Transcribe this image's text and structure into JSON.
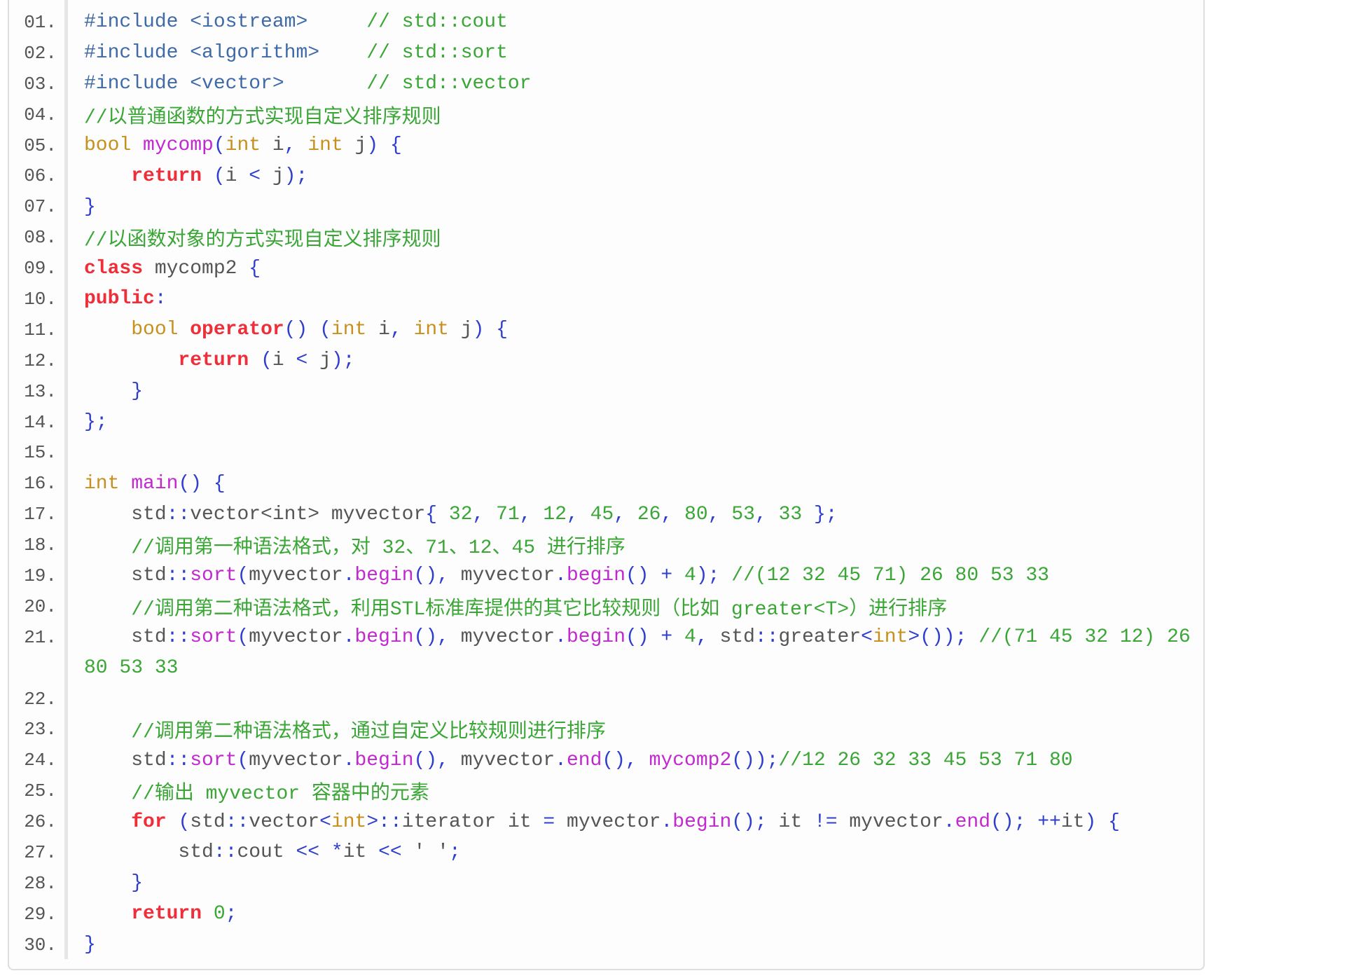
{
  "colors": {
    "preprocessor": "#3f6aa8",
    "comment": "#3aa636",
    "type": "#c7901d",
    "function": "#c128cf",
    "keyword": "#ee2f3a",
    "punctuation": "#2f3fcc",
    "number": "#3aa636",
    "identifier": "#555555",
    "line_number": "#555555"
  },
  "lines": [
    {
      "num": "01.",
      "tokens": [
        [
          "pre",
          "#include <iostream>"
        ],
        [
          "id",
          "     "
        ],
        [
          "cm",
          "// std::cout"
        ]
      ]
    },
    {
      "num": "02.",
      "tokens": [
        [
          "pre",
          "#include <algorithm>"
        ],
        [
          "id",
          "    "
        ],
        [
          "cm",
          "// std::sort"
        ]
      ]
    },
    {
      "num": "03.",
      "tokens": [
        [
          "pre",
          "#include <vector>"
        ],
        [
          "id",
          "       "
        ],
        [
          "cm",
          "// std::vector"
        ]
      ]
    },
    {
      "num": "04.",
      "tokens": [
        [
          "cm",
          "//以普通函数的方式实现自定义排序规则"
        ]
      ]
    },
    {
      "num": "05.",
      "tokens": [
        [
          "type",
          "bool"
        ],
        [
          "id",
          " "
        ],
        [
          "fn",
          "mycomp"
        ],
        [
          "p",
          "("
        ],
        [
          "type",
          "int"
        ],
        [
          "id",
          " i"
        ],
        [
          "p",
          ","
        ],
        [
          "id",
          " "
        ],
        [
          "type",
          "int"
        ],
        [
          "id",
          " j"
        ],
        [
          "p",
          ")"
        ],
        [
          "id",
          " "
        ],
        [
          "p",
          "{"
        ]
      ]
    },
    {
      "num": "06.",
      "tokens": [
        [
          "id",
          "    "
        ],
        [
          "kw",
          "return"
        ],
        [
          "id",
          " "
        ],
        [
          "p",
          "("
        ],
        [
          "id",
          "i "
        ],
        [
          "p",
          "<"
        ],
        [
          "id",
          " j"
        ],
        [
          "p",
          ");"
        ]
      ]
    },
    {
      "num": "07.",
      "tokens": [
        [
          "p",
          "}"
        ]
      ]
    },
    {
      "num": "08.",
      "tokens": [
        [
          "cm",
          "//以函数对象的方式实现自定义排序规则"
        ]
      ]
    },
    {
      "num": "09.",
      "tokens": [
        [
          "kw",
          "class"
        ],
        [
          "id",
          " mycomp2 "
        ],
        [
          "p",
          "{"
        ]
      ]
    },
    {
      "num": "10.",
      "tokens": [
        [
          "kw",
          "public"
        ],
        [
          "p",
          ":"
        ]
      ]
    },
    {
      "num": "11.",
      "tokens": [
        [
          "id",
          "    "
        ],
        [
          "type",
          "bool"
        ],
        [
          "id",
          " "
        ],
        [
          "kw",
          "operator"
        ],
        [
          "p",
          "()"
        ],
        [
          "id",
          " "
        ],
        [
          "p",
          "("
        ],
        [
          "type",
          "int"
        ],
        [
          "id",
          " i"
        ],
        [
          "p",
          ","
        ],
        [
          "id",
          " "
        ],
        [
          "type",
          "int"
        ],
        [
          "id",
          " j"
        ],
        [
          "p",
          ")"
        ],
        [
          "id",
          " "
        ],
        [
          "p",
          "{"
        ]
      ]
    },
    {
      "num": "12.",
      "tokens": [
        [
          "id",
          "        "
        ],
        [
          "kw",
          "return"
        ],
        [
          "id",
          " "
        ],
        [
          "p",
          "("
        ],
        [
          "id",
          "i "
        ],
        [
          "p",
          "<"
        ],
        [
          "id",
          " j"
        ],
        [
          "p",
          ");"
        ]
      ]
    },
    {
      "num": "13.",
      "tokens": [
        [
          "id",
          "    "
        ],
        [
          "p",
          "}"
        ]
      ]
    },
    {
      "num": "14.",
      "tokens": [
        [
          "p",
          "};"
        ]
      ]
    },
    {
      "num": "15.",
      "tokens": []
    },
    {
      "num": "16.",
      "tokens": [
        [
          "type",
          "int"
        ],
        [
          "id",
          " "
        ],
        [
          "fn",
          "main"
        ],
        [
          "p",
          "()"
        ],
        [
          "id",
          " "
        ],
        [
          "p",
          "{"
        ]
      ]
    },
    {
      "num": "17.",
      "tokens": [
        [
          "id",
          "    std"
        ],
        [
          "p",
          "::"
        ],
        [
          "id",
          "vector<int> myvector"
        ],
        [
          "p",
          "{"
        ],
        [
          "id",
          " "
        ],
        [
          "num",
          "32"
        ],
        [
          "p",
          ","
        ],
        [
          "id",
          " "
        ],
        [
          "num",
          "71"
        ],
        [
          "p",
          ","
        ],
        [
          "id",
          " "
        ],
        [
          "num",
          "12"
        ],
        [
          "p",
          ","
        ],
        [
          "id",
          " "
        ],
        [
          "num",
          "45"
        ],
        [
          "p",
          ","
        ],
        [
          "id",
          " "
        ],
        [
          "num",
          "26"
        ],
        [
          "p",
          ","
        ],
        [
          "id",
          " "
        ],
        [
          "num",
          "80"
        ],
        [
          "p",
          ","
        ],
        [
          "id",
          " "
        ],
        [
          "num",
          "53"
        ],
        [
          "p",
          ","
        ],
        [
          "id",
          " "
        ],
        [
          "num",
          "33"
        ],
        [
          "id",
          " "
        ],
        [
          "p",
          "};"
        ]
      ]
    },
    {
      "num": "18.",
      "tokens": [
        [
          "id",
          "    "
        ],
        [
          "cm",
          "//调用第一种语法格式，对 32、71、12、45 进行排序"
        ]
      ]
    },
    {
      "num": "19.",
      "tokens": [
        [
          "id",
          "    std"
        ],
        [
          "p",
          "::"
        ],
        [
          "fn",
          "sort"
        ],
        [
          "p",
          "("
        ],
        [
          "id",
          "myvector"
        ],
        [
          "p",
          "."
        ],
        [
          "fn",
          "begin"
        ],
        [
          "p",
          "(),"
        ],
        [
          "id",
          " myvector"
        ],
        [
          "p",
          "."
        ],
        [
          "fn",
          "begin"
        ],
        [
          "p",
          "()"
        ],
        [
          "id",
          " "
        ],
        [
          "p",
          "+"
        ],
        [
          "id",
          " "
        ],
        [
          "num",
          "4"
        ],
        [
          "p",
          ");"
        ],
        [
          "id",
          " "
        ],
        [
          "cm",
          "//(12 32 45 71) 26 80 53 33"
        ]
      ]
    },
    {
      "num": "20.",
      "tokens": [
        [
          "id",
          "    "
        ],
        [
          "cm",
          "//调用第二种语法格式，利用STL标准库提供的其它比较规则（比如 greater<T>）进行排序"
        ]
      ]
    },
    {
      "num": "21.",
      "tokens": [
        [
          "id",
          "    std"
        ],
        [
          "p",
          "::"
        ],
        [
          "fn",
          "sort"
        ],
        [
          "p",
          "("
        ],
        [
          "id",
          "myvector"
        ],
        [
          "p",
          "."
        ],
        [
          "fn",
          "begin"
        ],
        [
          "p",
          "(),"
        ],
        [
          "id",
          " myvector"
        ],
        [
          "p",
          "."
        ],
        [
          "fn",
          "begin"
        ],
        [
          "p",
          "()"
        ],
        [
          "id",
          " "
        ],
        [
          "p",
          "+"
        ],
        [
          "id",
          " "
        ],
        [
          "num",
          "4"
        ],
        [
          "p",
          ","
        ],
        [
          "id",
          " std"
        ],
        [
          "p",
          "::"
        ],
        [
          "id",
          "greater"
        ],
        [
          "p",
          "<"
        ],
        [
          "type",
          "int"
        ],
        [
          "p",
          ">());"
        ],
        [
          "id",
          " "
        ],
        [
          "cm",
          "//(71 45 32 12) 26"
        ]
      ]
    },
    {
      "num": "",
      "tokens": [
        [
          "cm",
          "80 53 33"
        ]
      ]
    },
    {
      "num": "22.",
      "tokens": []
    },
    {
      "num": "23.",
      "tokens": [
        [
          "id",
          "    "
        ],
        [
          "cm",
          "//调用第二种语法格式，通过自定义比较规则进行排序"
        ]
      ]
    },
    {
      "num": "24.",
      "tokens": [
        [
          "id",
          "    std"
        ],
        [
          "p",
          "::"
        ],
        [
          "fn",
          "sort"
        ],
        [
          "p",
          "("
        ],
        [
          "id",
          "myvector"
        ],
        [
          "p",
          "."
        ],
        [
          "fn",
          "begin"
        ],
        [
          "p",
          "(),"
        ],
        [
          "id",
          " myvector"
        ],
        [
          "p",
          "."
        ],
        [
          "fn",
          "end"
        ],
        [
          "p",
          "(),"
        ],
        [
          "id",
          " "
        ],
        [
          "fn",
          "mycomp2"
        ],
        [
          "p",
          "());"
        ],
        [
          "cm",
          "//12 26 32 33 45 53 71 80"
        ]
      ]
    },
    {
      "num": "25.",
      "tokens": [
        [
          "id",
          "    "
        ],
        [
          "cm",
          "//输出 myvector 容器中的元素"
        ]
      ]
    },
    {
      "num": "26.",
      "tokens": [
        [
          "id",
          "    "
        ],
        [
          "kw",
          "for"
        ],
        [
          "id",
          " "
        ],
        [
          "p",
          "("
        ],
        [
          "id",
          "std"
        ],
        [
          "p",
          "::"
        ],
        [
          "id",
          "vector"
        ],
        [
          "p",
          "<"
        ],
        [
          "type",
          "int"
        ],
        [
          "p",
          ">::"
        ],
        [
          "id",
          "iterator it "
        ],
        [
          "p",
          "="
        ],
        [
          "id",
          " myvector"
        ],
        [
          "p",
          "."
        ],
        [
          "fn",
          "begin"
        ],
        [
          "p",
          "();"
        ],
        [
          "id",
          " it "
        ],
        [
          "p",
          "!="
        ],
        [
          "id",
          " myvector"
        ],
        [
          "p",
          "."
        ],
        [
          "fn",
          "end"
        ],
        [
          "p",
          "();"
        ],
        [
          "id",
          " "
        ],
        [
          "p",
          "++"
        ],
        [
          "id",
          "it"
        ],
        [
          "p",
          ")"
        ],
        [
          "id",
          " "
        ],
        [
          "p",
          "{"
        ]
      ]
    },
    {
      "num": "27.",
      "tokens": [
        [
          "id",
          "        std"
        ],
        [
          "p",
          "::"
        ],
        [
          "id",
          "cout "
        ],
        [
          "p",
          "<<"
        ],
        [
          "id",
          " "
        ],
        [
          "p",
          "*"
        ],
        [
          "id",
          "it "
        ],
        [
          "p",
          "<<"
        ],
        [
          "id",
          " ' '"
        ],
        [
          "p",
          ";"
        ]
      ]
    },
    {
      "num": "28.",
      "tokens": [
        [
          "id",
          "    "
        ],
        [
          "p",
          "}"
        ]
      ]
    },
    {
      "num": "29.",
      "tokens": [
        [
          "id",
          "    "
        ],
        [
          "kw",
          "return"
        ],
        [
          "id",
          " "
        ],
        [
          "num",
          "0"
        ],
        [
          "p",
          ";"
        ]
      ]
    },
    {
      "num": "30.",
      "tokens": [
        [
          "p",
          "}"
        ]
      ]
    }
  ]
}
